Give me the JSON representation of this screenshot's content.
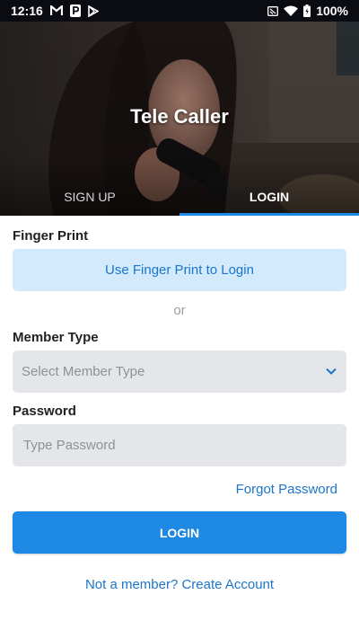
{
  "status_bar": {
    "time": "12:16",
    "battery": "100%",
    "left_icons": [
      "gmail-icon",
      "parking-icon",
      "play-store-icon"
    ],
    "right_icons": [
      "cast-icon",
      "wifi-icon",
      "battery-icon"
    ]
  },
  "header": {
    "title": "Tele Caller",
    "tabs": [
      {
        "label": "SIGN UP",
        "active": false
      },
      {
        "label": "LOGIN",
        "active": true
      }
    ]
  },
  "form": {
    "fingerprint": {
      "label": "Finger Print",
      "button_label": "Use Finger Print to Login"
    },
    "or_text": "or",
    "member_type": {
      "label": "Member Type",
      "placeholder": "Select Member Type"
    },
    "password": {
      "label": "Password",
      "placeholder": "Type Password"
    },
    "forgot_password": "Forgot Password",
    "login_button": "LOGIN",
    "create_account": "Not a member? Create Account"
  },
  "colors": {
    "accent": "#1e88e5",
    "link": "#1b75c9",
    "fingerprint_button_bg": "#d3eafd",
    "field_bg": "#e4e6ea"
  }
}
